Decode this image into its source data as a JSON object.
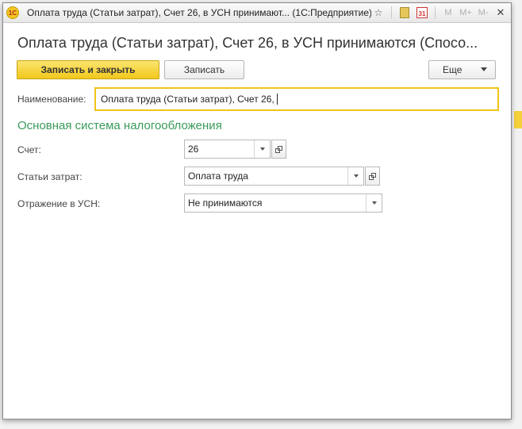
{
  "window": {
    "title": "Оплата труда (Статьи затрат), Счет 26, в УСН принимают...  (1С:Предприятие)",
    "app_icon_text": "1С"
  },
  "titlebar": {
    "icons": [
      "star-icon",
      "calculator-icon",
      "calendar-icon",
      "m-icon",
      "m-plus-icon",
      "m-minus-icon",
      "close-icon"
    ],
    "calendar_day": "31",
    "m_label": "M",
    "m_plus_label": "M+",
    "m_minus_label": "M-",
    "close_glyph": "✕"
  },
  "form": {
    "title": "Оплата труда (Статьи затрат), Счет 26, в УСН принимаются (Спосо...",
    "buttons": {
      "save_close": "Записать и закрыть",
      "save": "Записать",
      "more": "Еще"
    },
    "name_label": "Наименование:",
    "name_value": "Оплата труда (Статьи затрат), Счет 26,",
    "section_title": "Основная система налогообложения",
    "fields": {
      "account": {
        "label": "Счет:",
        "value": "26"
      },
      "cost_item": {
        "label": "Статьи затрат:",
        "value": "Оплата труда"
      },
      "usn": {
        "label": "Отражение в УСН:",
        "value": "Не принимаются"
      }
    }
  },
  "colors": {
    "primary_button": "#f2c81c",
    "section_title": "#3a9a5a",
    "focus_border": "#f0c419"
  }
}
